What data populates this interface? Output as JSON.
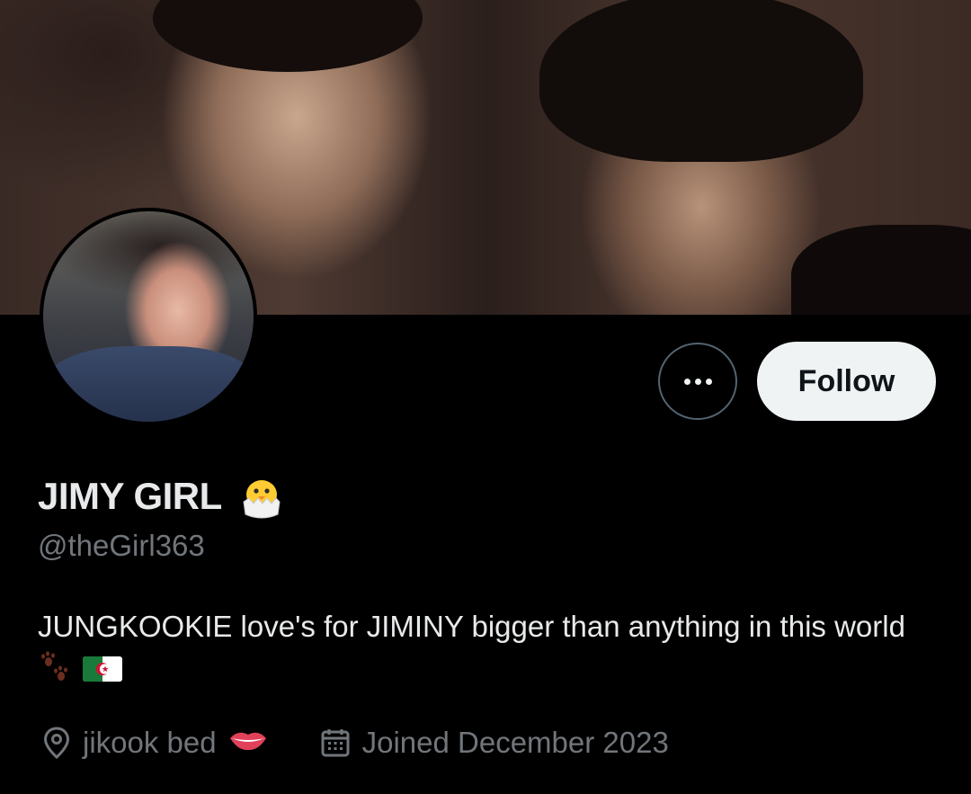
{
  "profile": {
    "display_name": "JIMY GIRL",
    "name_emoji": "hatching-chick",
    "handle": "@theGirl363",
    "bio": "JUNGKOOKIE love's for JIMINY bigger than anything in this world",
    "bio_emojis": [
      "paw-prints",
      "algeria-flag"
    ],
    "location": "jikook bed",
    "location_emoji": "lips",
    "joined": "Joined December 2023"
  },
  "actions": {
    "follow_label": "Follow",
    "more_icon": "more-dots-icon"
  },
  "colors": {
    "background": "#000000",
    "primary_text": "#e7e9ea",
    "secondary_text": "#71767b",
    "follow_bg": "#eff3f4",
    "border": "#536471"
  }
}
